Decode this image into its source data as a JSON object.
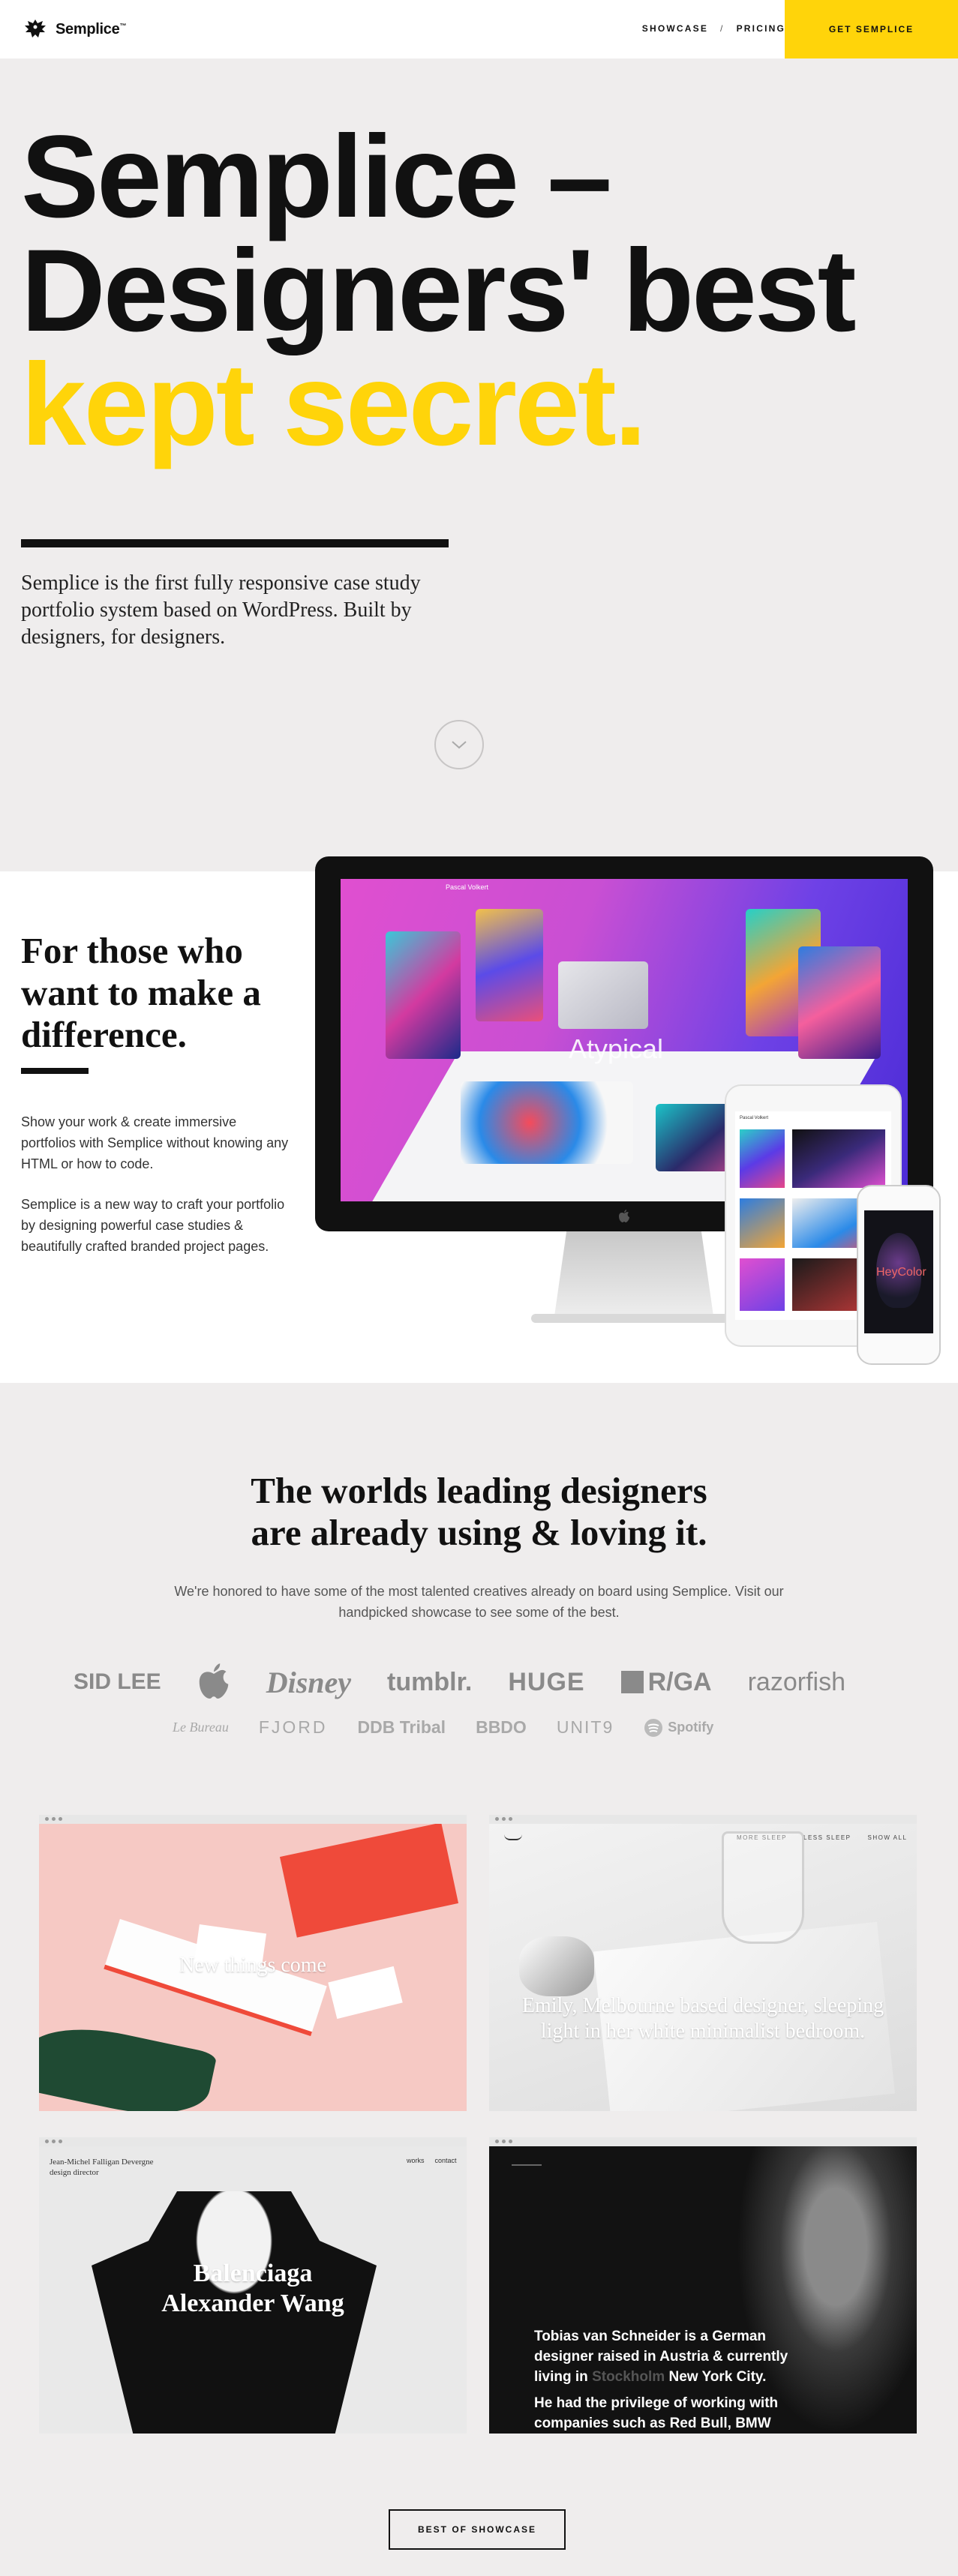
{
  "header": {
    "logo_text": "Semplice",
    "logo_tm": "™",
    "nav": [
      "SHOWCASE",
      "PRICING"
    ],
    "nav_sep": "/",
    "cta": "GET SEMPLICE"
  },
  "hero": {
    "line1": "Semplice –",
    "line2": "Designers' best",
    "line3": "kept secret.",
    "intro": "Semplice is the first fully responsive case study portfolio system based on WordPress. Built by designers, for designers."
  },
  "features": {
    "heading": "For those who want to make a difference.",
    "p1": "Show your work & create immersive portfolios with Semplice without knowing any HTML or how to code.",
    "p2": "Semplice is a new way to craft your portfolio by designing powerful case studies & beautifully crafted branded project pages.",
    "screen_title": "Atypical",
    "screen_name": "Pascal Volkert",
    "phone_label": "HeyColor"
  },
  "clients": {
    "heading_1": "The worlds leading designers",
    "heading_2": "are already using & loving it.",
    "text": "We're honored to have some of the most talented creatives already on board using Semplice. Visit our handpicked showcase to see some of the best.",
    "logos_row1": [
      "SID LEE",
      "",
      "Disney",
      "tumblr.",
      "HUGE",
      "R/GA",
      "razorfish"
    ],
    "logos_row2": [
      "Le Bureau",
      "FJORD",
      "DDB Tribal",
      "BBDO",
      "UNIT9",
      "Spotify"
    ]
  },
  "showcase": {
    "card1_caption": "New things come",
    "card2_caption": "Emily, Melbourne based designer, sleeping light in her white minimalist bedroom.",
    "card2_nav": [
      "MORE SLEEP",
      "LESS SLEEP",
      "SHOW ALL"
    ],
    "card3_caption_1": "Balenciaga",
    "card3_caption_2": "Alexander Wang",
    "card3_name": "Jean-Michel Falligan Devergne",
    "card3_role": "design director",
    "card3_nav": [
      "works",
      "contact"
    ],
    "card4_text_1": "Tobias van Schneider is a German designer raised in Austria & currently living in",
    "card4_city_1": "Stockholm",
    "card4_city_2": "New York City.",
    "card4_text_2": "He had the privilege of working with companies such as Red Bull, BMW",
    "button": "BEST OF SHOWCASE"
  },
  "colors": {
    "accent": "#ffd40a",
    "background": "#efeded",
    "ink": "#111111"
  }
}
